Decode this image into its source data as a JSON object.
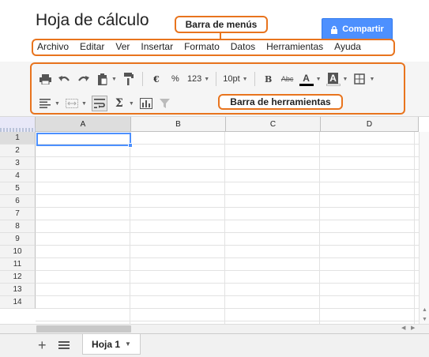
{
  "title": "Hoja de cálculo",
  "share_label": "Compartir",
  "annotations": {
    "menu_bar": "Barra de menús",
    "toolbar": "Barra de herramientas"
  },
  "menu": [
    "Archivo",
    "Editar",
    "Ver",
    "Insertar",
    "Formato",
    "Datos",
    "Herramientas",
    "Ayuda"
  ],
  "toolbar": {
    "currency": "€",
    "percent": "%",
    "number_format": "123",
    "font_size": "10pt",
    "bold": "B",
    "strikethrough": "Abc",
    "text_color": "A",
    "fill_color": "A",
    "sum": "Σ"
  },
  "columns": [
    "A",
    "B",
    "C",
    "D"
  ],
  "rows": [
    "1",
    "2",
    "3",
    "4",
    "5",
    "6",
    "7",
    "8",
    "9",
    "10",
    "11",
    "12",
    "13",
    "14"
  ],
  "sheet_tab": "Hoja 1",
  "colors": {
    "accent": "#4d90fe",
    "callout": "#e8741e"
  }
}
